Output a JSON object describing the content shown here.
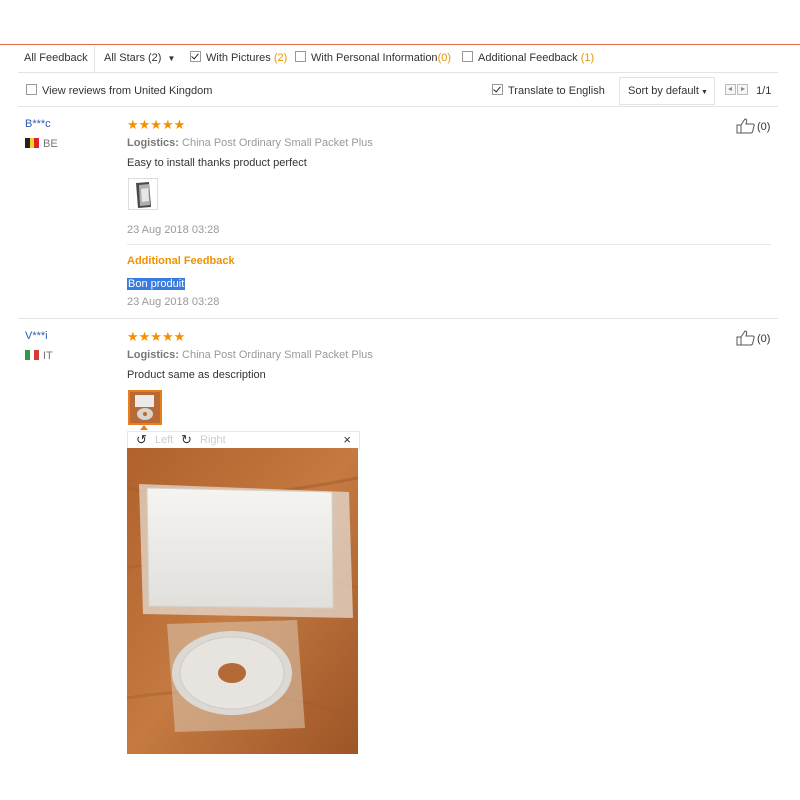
{
  "filters": {
    "all_feedback": "All Feedback",
    "all_stars": "All Stars (2)",
    "with_pictures_label": "With Pictures",
    "with_pictures_count": "(2)",
    "personal_info_label": "With Personal Information",
    "personal_info_count": "(0)",
    "additional_label": "Additional Feedback",
    "additional_count": "(1)",
    "view_reviews_from": "View reviews from United Kingdom",
    "translate": "Translate to English",
    "sort": "Sort by default",
    "page": "1/1"
  },
  "colors": {
    "accent": "#f29100",
    "link": "#2a5db0",
    "highlight": "#3a7be0",
    "selected_border": "#e87e1c"
  },
  "reviews": [
    {
      "user": "B***c",
      "country": "BE",
      "stars": "★★★★★",
      "rating": 5,
      "logistics_label": "Logistics:",
      "logistics_value": "China Post Ordinary Small Packet Plus",
      "text": "Easy to install thanks product perfect",
      "date": "23 Aug 2018 03:28",
      "likes": "(0)",
      "additional_title": "Additional Feedback",
      "additional_text": "Bon produit",
      "additional_date": "23 Aug 2018 03:28"
    },
    {
      "user": "V***i",
      "country": "IT",
      "stars": "★★★★★",
      "rating": 5,
      "logistics_label": "Logistics:",
      "logistics_value": "China Post Ordinary Small Packet Plus",
      "text": "Product same as description",
      "likes": "(0)"
    }
  ],
  "viewer": {
    "left": "Left",
    "right": "Right",
    "close": "×"
  },
  "icons": {
    "like": "thumb-up-icon",
    "rotate_left": "rotate-left-icon",
    "rotate_right": "rotate-right-icon",
    "close": "close-icon"
  }
}
